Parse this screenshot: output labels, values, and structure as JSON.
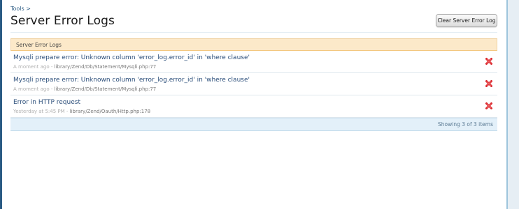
{
  "breadcrumb": {
    "label": "Tools >"
  },
  "page": {
    "title": "Server Error Logs"
  },
  "toolbar": {
    "clear_label": "Clear Server Error Log"
  },
  "table": {
    "header": "Server Error Logs",
    "rows": [
      {
        "message": "Mysqli prepare error: Unknown column 'error_log.error_id' in 'where clause'",
        "time": "A moment ago",
        "separator": "-",
        "file": "library/Zend/Db/Statement/Mysqli.php:77"
      },
      {
        "message": "Mysqli prepare error: Unknown column 'error_log.error_id' in 'where clause'",
        "time": "A moment ago",
        "separator": "-",
        "file": "library/Zend/Db/Statement/Mysqli.php:77"
      },
      {
        "message": "Error in HTTP request",
        "time": "Yesterday at 5:45 PM",
        "separator": "-",
        "file": "library/Zend/Oauth/Http.php:178"
      }
    ],
    "footer": "Showing 3 of 3 items"
  },
  "icons": {
    "delete": "delete-icon"
  },
  "colors": {
    "delete": "#d9262c",
    "link": "#2b4e7a",
    "header_bg": "#fce9c9",
    "footer_bg": "#e3f0f9"
  }
}
